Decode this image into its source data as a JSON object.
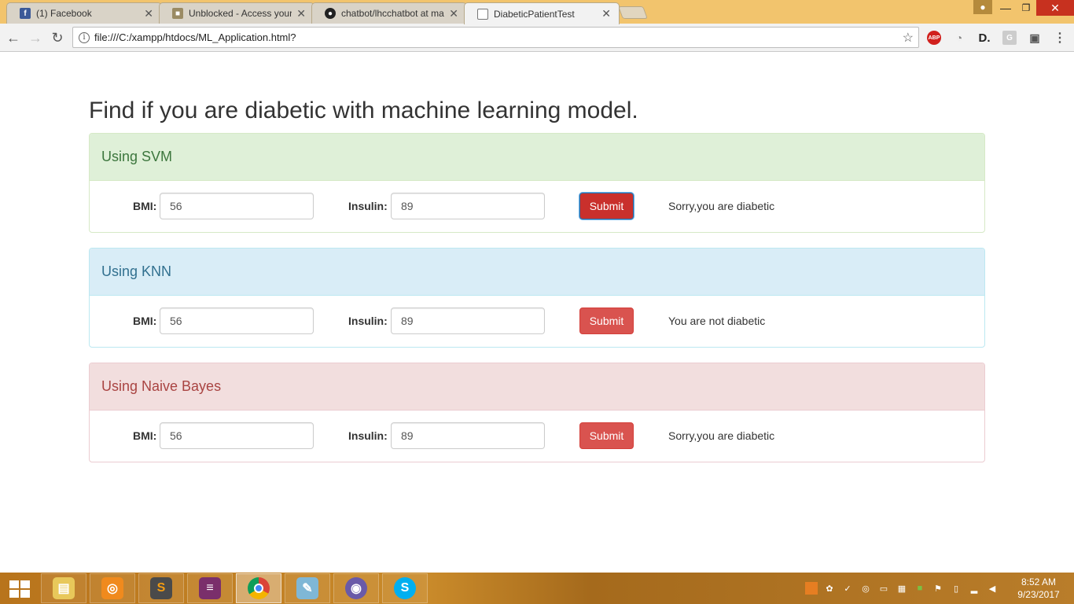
{
  "browser": {
    "tabs": [
      {
        "title": "(1) Facebook",
        "icon": "facebook-icon"
      },
      {
        "title": "Unblocked - Access your",
        "icon": "cube-icon"
      },
      {
        "title": "chatbot/lhcchatbot at ma",
        "icon": "github-icon"
      },
      {
        "title": "DiabeticPatientTest",
        "icon": "page-icon"
      }
    ],
    "url": "file:///C:/xampp/htdocs/ML_Application.html?"
  },
  "page": {
    "title": "Find if you are diabetic with machine learning model.",
    "panels": [
      {
        "heading": "Using SVM",
        "bmi_label": "BMI:",
        "bmi_value": "56",
        "insulin_label": "Insulin:",
        "insulin_value": "89",
        "submit_label": "Submit",
        "result": "Sorry,you are diabetic"
      },
      {
        "heading": "Using KNN",
        "bmi_label": "BMI:",
        "bmi_value": "56",
        "insulin_label": "Insulin:",
        "insulin_value": "89",
        "submit_label": "Submit",
        "result": "You are not diabetic"
      },
      {
        "heading": "Using Naive Bayes",
        "bmi_label": "BMI:",
        "bmi_value": "56",
        "insulin_label": "Insulin:",
        "insulin_value": "89",
        "submit_label": "Submit",
        "result": "Sorry,you are diabetic"
      }
    ]
  },
  "taskbar": {
    "time": "8:52 AM",
    "date": "9/23/2017"
  },
  "colors": {
    "svm_heading_bg": "#dff0d8",
    "knn_heading_bg": "#d9edf7",
    "naive_bayes_heading_bg": "#f2dede",
    "submit_button": "#d9534f",
    "tabstrip": "#f2c46d"
  }
}
